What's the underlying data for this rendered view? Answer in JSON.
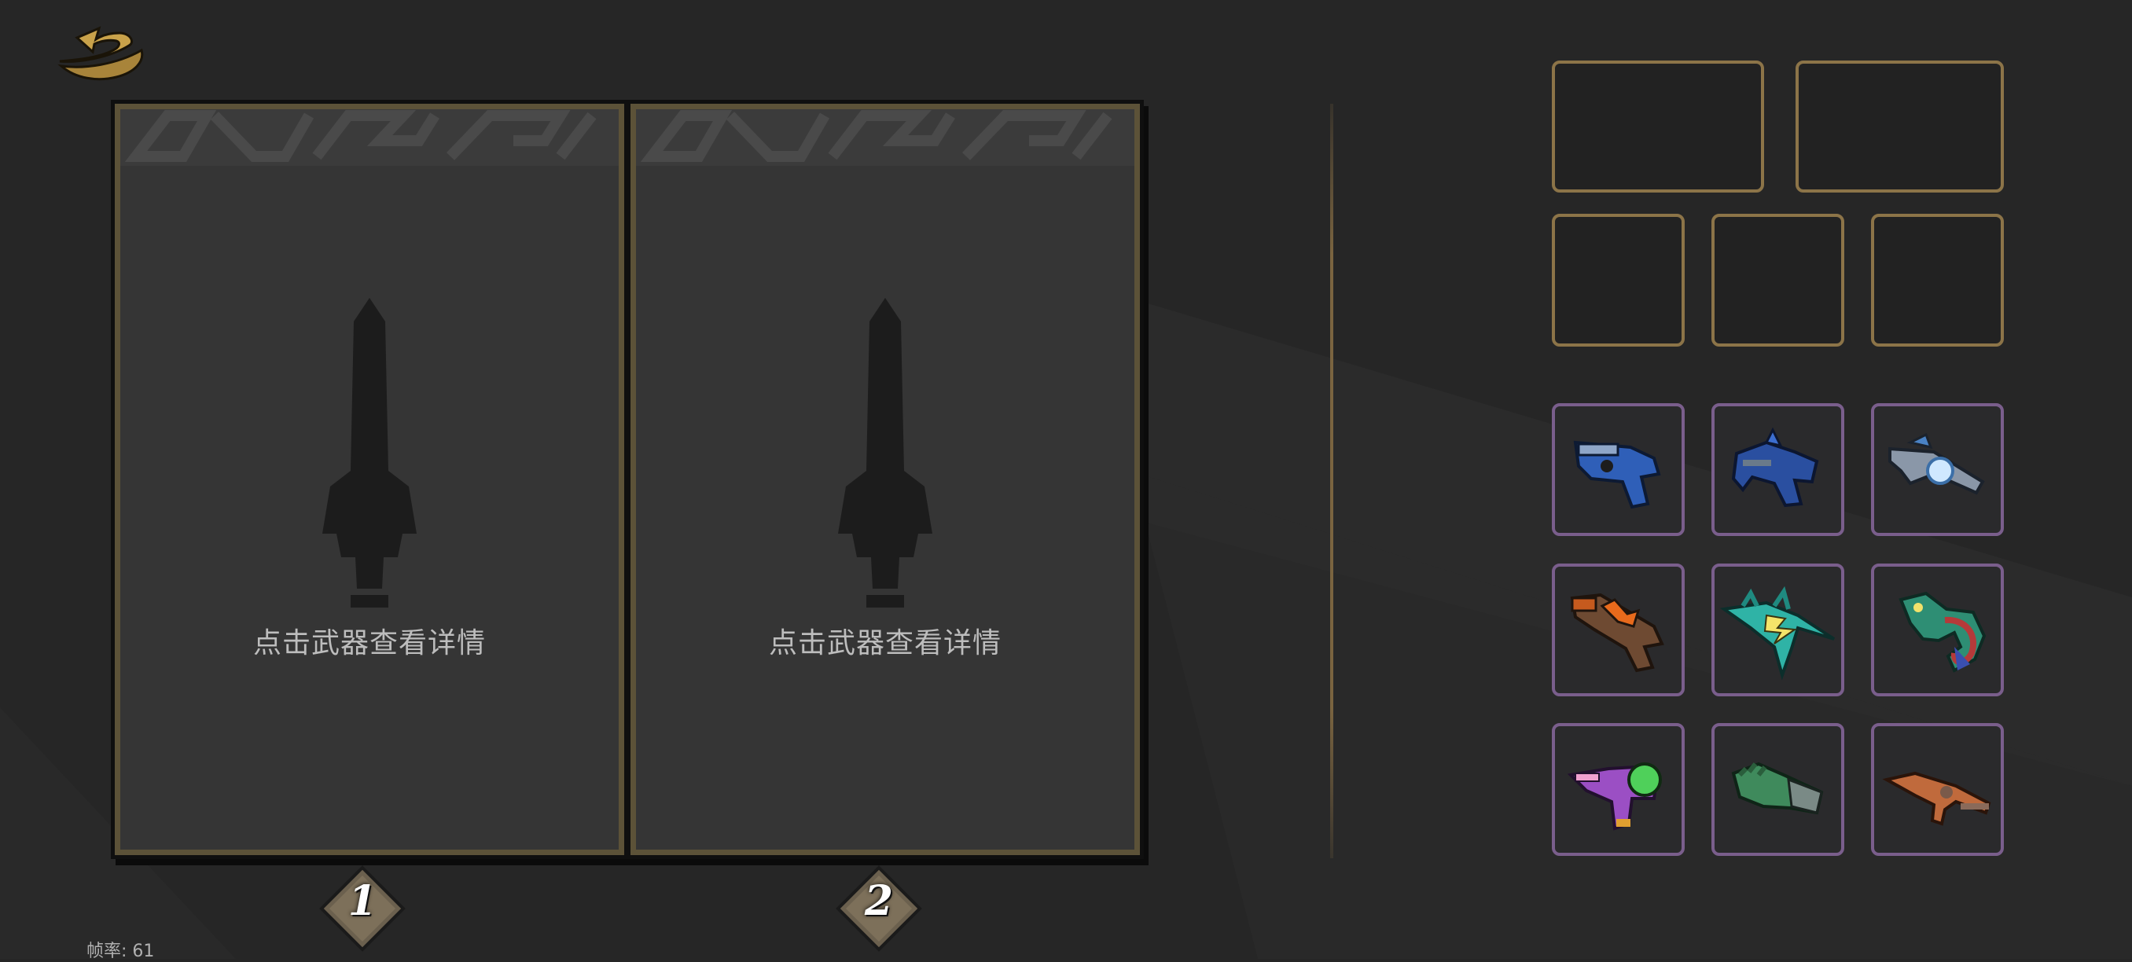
{
  "top_bar": {
    "back_icon": "gold-return-arrow-icon"
  },
  "slots": [
    {
      "label": "1",
      "hint": "点击武器查看详情",
      "placeholder_icon": "sword-silhouette-icon"
    },
    {
      "label": "2",
      "hint": "点击武器查看详情",
      "placeholder_icon": "sword-silhouette-icon"
    }
  ],
  "fps_text": "帧率: 61",
  "colors": {
    "background": "#262626",
    "card_fill": "#353535",
    "card_border": "#5c5238",
    "slot_border_gold": "#8c7448",
    "weapon_border_purple": "#7a5e8c",
    "back_icon_gold": "#c9a24a"
  },
  "equipment_slots": {
    "wide_count": 2,
    "square_count": 3,
    "state": "empty"
  },
  "weapons": [
    {
      "icon": "blue-blaster-pistol-icon"
    },
    {
      "icon": "blue-dragon-pistol-icon"
    },
    {
      "icon": "crystal-orb-rifle-icon"
    },
    {
      "icon": "orange-flame-shotgun-icon"
    },
    {
      "icon": "teal-lightning-spear-gun-icon"
    },
    {
      "icon": "chameleon-creature-gun-icon"
    },
    {
      "icon": "purple-green-ray-gun-icon"
    },
    {
      "icon": "green-gauntlet-icon"
    },
    {
      "icon": "rusty-orange-rifle-icon"
    }
  ]
}
